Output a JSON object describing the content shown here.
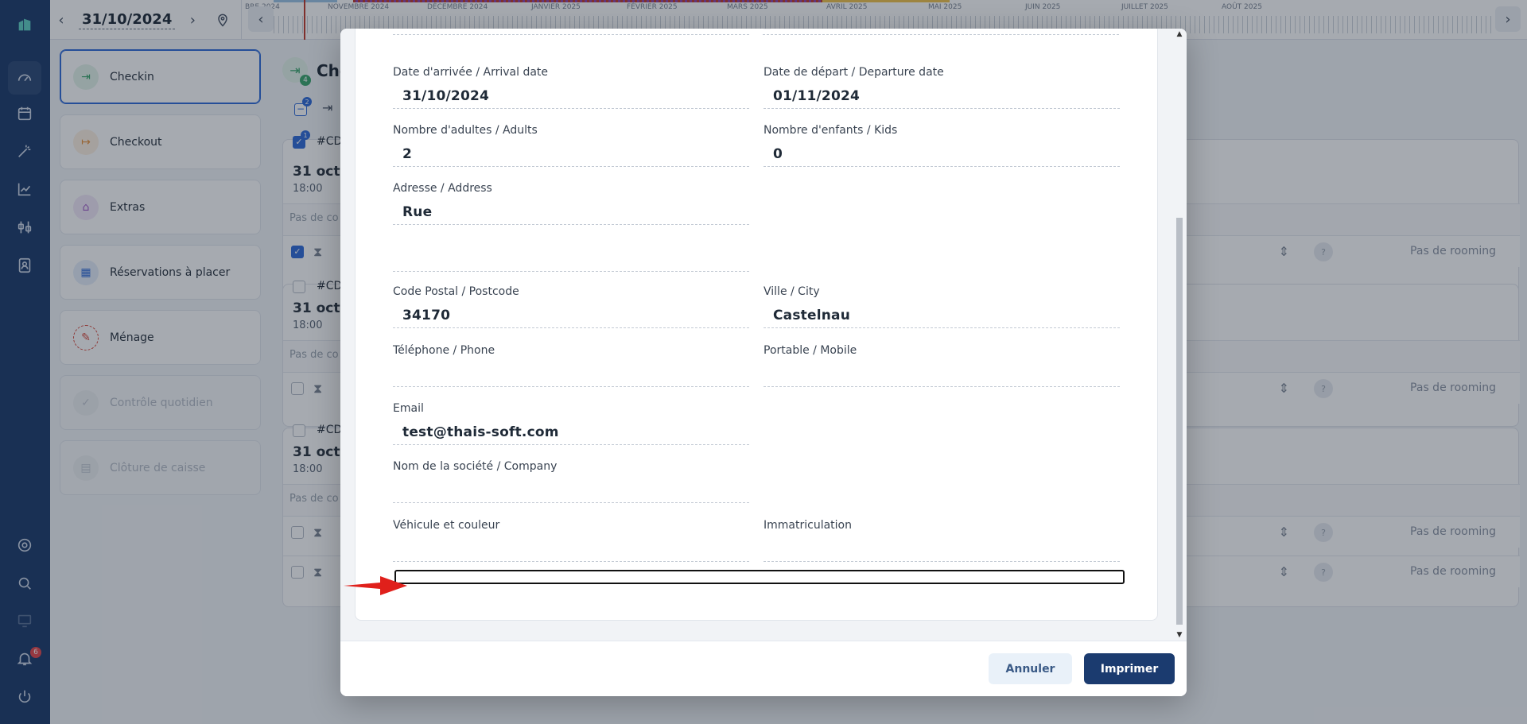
{
  "topbar": {
    "date": "31/10/2024",
    "months": [
      "BRE 2024",
      "NOVEMBRE 2024",
      "DÉCEMBRE 2024",
      "JANVIER 2025",
      "FÉVRIER 2025",
      "MARS 2025",
      "AVRIL 2025",
      "MAI 2025",
      "JUIN 2025",
      "JUILLET 2025",
      "AOÛT 2025"
    ]
  },
  "rail": {
    "notification_count": "6"
  },
  "menu": {
    "items": [
      {
        "label": "Checkin",
        "icon": "checkin-icon",
        "color": "#3aa76d"
      },
      {
        "label": "Checkout",
        "icon": "checkout-icon",
        "color": "#e8913a"
      },
      {
        "label": "Extras",
        "icon": "basket-icon",
        "color": "#a35ec9"
      },
      {
        "label": "Réservations à placer",
        "icon": "calendar-icon",
        "color": "#2f6bd9"
      },
      {
        "label": "Ménage",
        "icon": "broom-icon",
        "color": "#d94a3d"
      },
      {
        "label": "Contrôle quotidien",
        "icon": "check-icon",
        "color": "#b5bcc7"
      },
      {
        "label": "Clôture de caisse",
        "icon": "register-icon",
        "color": "#b5bcc7"
      }
    ]
  },
  "background": {
    "title": "Che",
    "badges": {
      "checkin_count": "4",
      "selection_count": "2",
      "card_selection": "1"
    },
    "cards": [
      {
        "ref": "#CD",
        "date": "31 oct. 2",
        "time": "18:00",
        "note": "Pas de co",
        "rooming": "Pas de rooming"
      },
      {
        "ref": "#CD",
        "date": "31 oct. 2",
        "time": "18:00",
        "note": "Pas de co",
        "rooming": "Pas de rooming"
      },
      {
        "ref": "#CD",
        "date": "31 oct. 2",
        "time": "18:00",
        "note": "Pas de co",
        "rooming": "Pas de rooming",
        "rooming2": "Pas de rooming"
      }
    ],
    "avatar_placeholder": "?"
  },
  "form": {
    "arrival": {
      "label": "Date d'arrivée / Arrival date",
      "value": "31/10/2024"
    },
    "departure": {
      "label": "Date de départ / Departure date",
      "value": "01/11/2024"
    },
    "adults": {
      "label": "Nombre d'adultes / Adults",
      "value": "2"
    },
    "kids": {
      "label": "Nombre d'enfants / Kids",
      "value": "0"
    },
    "address": {
      "label": "Adresse / Address",
      "value": "Rue",
      "value2": ""
    },
    "postcode": {
      "label": "Code Postal / Postcode",
      "value": "34170"
    },
    "city": {
      "label": "Ville / City",
      "value": "Castelnau"
    },
    "phone": {
      "label": "Téléphone / Phone",
      "value": ""
    },
    "mobile": {
      "label": "Portable / Mobile",
      "value": ""
    },
    "email": {
      "label": "Email",
      "value": "test@thais-soft.com"
    },
    "company": {
      "label": "Nom de la société / Company",
      "value": ""
    },
    "vehicle": {
      "label": "Véhicule et couleur",
      "value": ""
    },
    "plate": {
      "label": "Immatriculation",
      "value": ""
    }
  },
  "footer": {
    "cancel_label": "Annuler",
    "print_label": "Imprimer"
  },
  "colors": {
    "rail": "#1c3a6b",
    "primary": "#1b3b6f",
    "annotation_arrow": "#e0201b"
  }
}
